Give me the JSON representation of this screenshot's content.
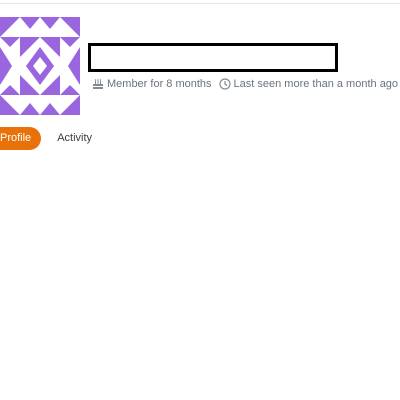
{
  "profile": {
    "member_for": "Member for 8 months",
    "last_seen": "Last seen more than a month ago"
  },
  "tabs": [
    {
      "label": "Profile",
      "active": true
    },
    {
      "label": "Activity",
      "active": false
    }
  ],
  "icons": {
    "member": "cake-icon",
    "last_seen": "clock-icon"
  },
  "colors": {
    "avatar": "#9966e0",
    "active_tab": "#e8710a",
    "meta_text": "#6a737c",
    "redaction": "#000000"
  }
}
